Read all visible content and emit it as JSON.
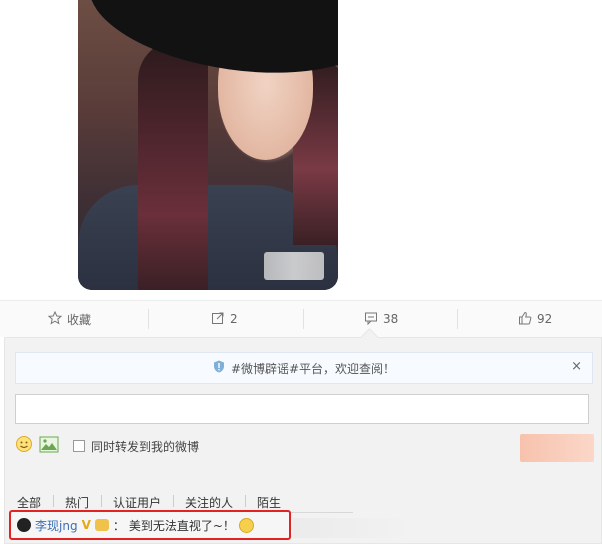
{
  "actions": {
    "favorite_label": "收藏",
    "repost_count": "2",
    "comment_count": "38",
    "like_count": "92"
  },
  "notice": {
    "text": "#微博辟谣#平台，欢迎查阅！",
    "close": "×"
  },
  "composer": {
    "input_value": "",
    "sync_repost_label": "同时转发到我的微博"
  },
  "filters": [
    "全部",
    "热门",
    "认证用户",
    "关注的人",
    "陌生"
  ],
  "comment": {
    "username": "李现jng",
    "badge": "V",
    "separator": "：",
    "text": "美到无法直视了~！"
  }
}
